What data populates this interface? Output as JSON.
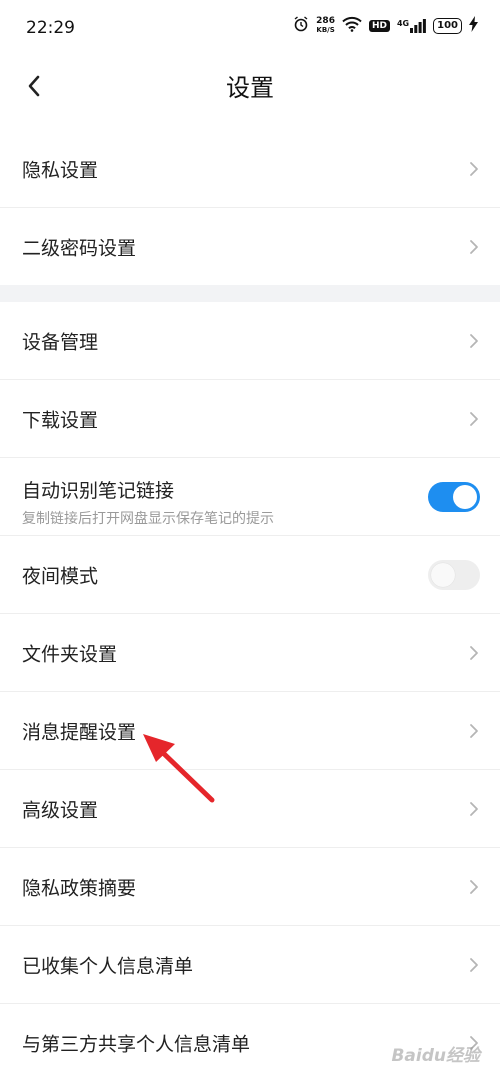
{
  "status_bar": {
    "time": "22:29",
    "speed_value": "286",
    "speed_unit": "KB/S",
    "hd": "HD",
    "network": "4G",
    "battery": "100"
  },
  "header": {
    "title": "设置"
  },
  "group1": [
    {
      "label": "隐私设置"
    },
    {
      "label": "二级密码设置"
    }
  ],
  "group2": {
    "device_management": "设备管理",
    "download_settings": "下载设置",
    "auto_recognize": {
      "label": "自动识别笔记链接",
      "description": "复制链接后打开网盘显示保存笔记的提示",
      "enabled": true
    },
    "night_mode": {
      "label": "夜间模式",
      "enabled": false
    },
    "folder_settings": "文件夹设置",
    "message_reminder": "消息提醒设置",
    "advanced_settings": "高级设置",
    "privacy_policy_summary": "隐私政策摘要",
    "collected_info_list": "已收集个人信息清单",
    "shared_info_list": "与第三方共享个人信息清单"
  },
  "colors": {
    "toggle_on": "#1e8ef0",
    "annotation_arrow": "#e5262b"
  },
  "watermark": "Baidu经验"
}
